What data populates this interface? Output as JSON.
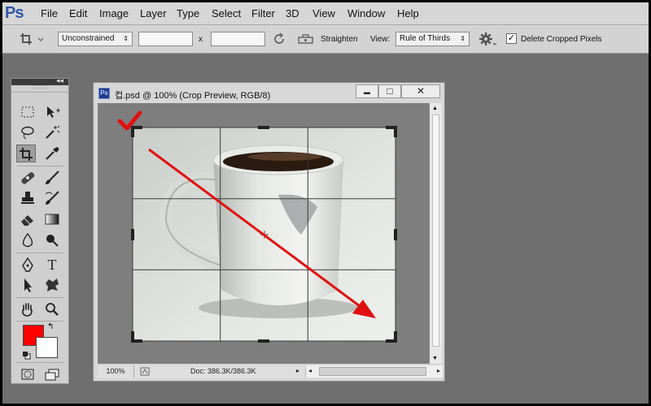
{
  "app": {
    "logo": "Ps"
  },
  "menu": [
    "File",
    "Edit",
    "Image",
    "Layer",
    "Type",
    "Select",
    "Filter",
    "3D",
    "View",
    "Window",
    "Help"
  ],
  "options_bar": {
    "tool_icon": "crop-icon",
    "ratio_value": "Unconstrained",
    "width_value": "",
    "times_label": "x",
    "height_value": "",
    "straighten_label": "Straighten",
    "view_label": "View:",
    "view_value": "Rule of Thirds",
    "delete_cropped_label": "Delete Cropped Pixels",
    "delete_cropped_checked": true
  },
  "tools": [
    "rectangular-marquee-icon",
    "move-icon",
    "lasso-icon",
    "magic-wand-icon",
    "crop-icon",
    "eyedropper-icon",
    "spot-healing-icon",
    "brush-icon",
    "clone-stamp-icon",
    "history-brush-icon",
    "eraser-icon",
    "gradient-icon",
    "blur-icon",
    "dodge-icon",
    "pen-icon",
    "type-icon",
    "path-selection-icon",
    "custom-shape-icon",
    "hand-icon",
    "zoom-icon"
  ],
  "type_tool_glyph": "T",
  "colors": {
    "foreground": "#ff0000",
    "background": "#ffffff",
    "annotation": "#e01010"
  },
  "document": {
    "title": "컵.psd @ 100% (Crop Preview, RGB/8)",
    "badge": "Ps",
    "min_glyph": "▬",
    "max_glyph": "□",
    "close_glyph": "✕",
    "zoom": "100%",
    "doc_size": "Doc: 386.3K/386.3K"
  },
  "overlay": {
    "view_mode": "rule-of-thirds",
    "annotation_check": "checkmark-icon",
    "annotation_arrow": "arrow-icon"
  }
}
